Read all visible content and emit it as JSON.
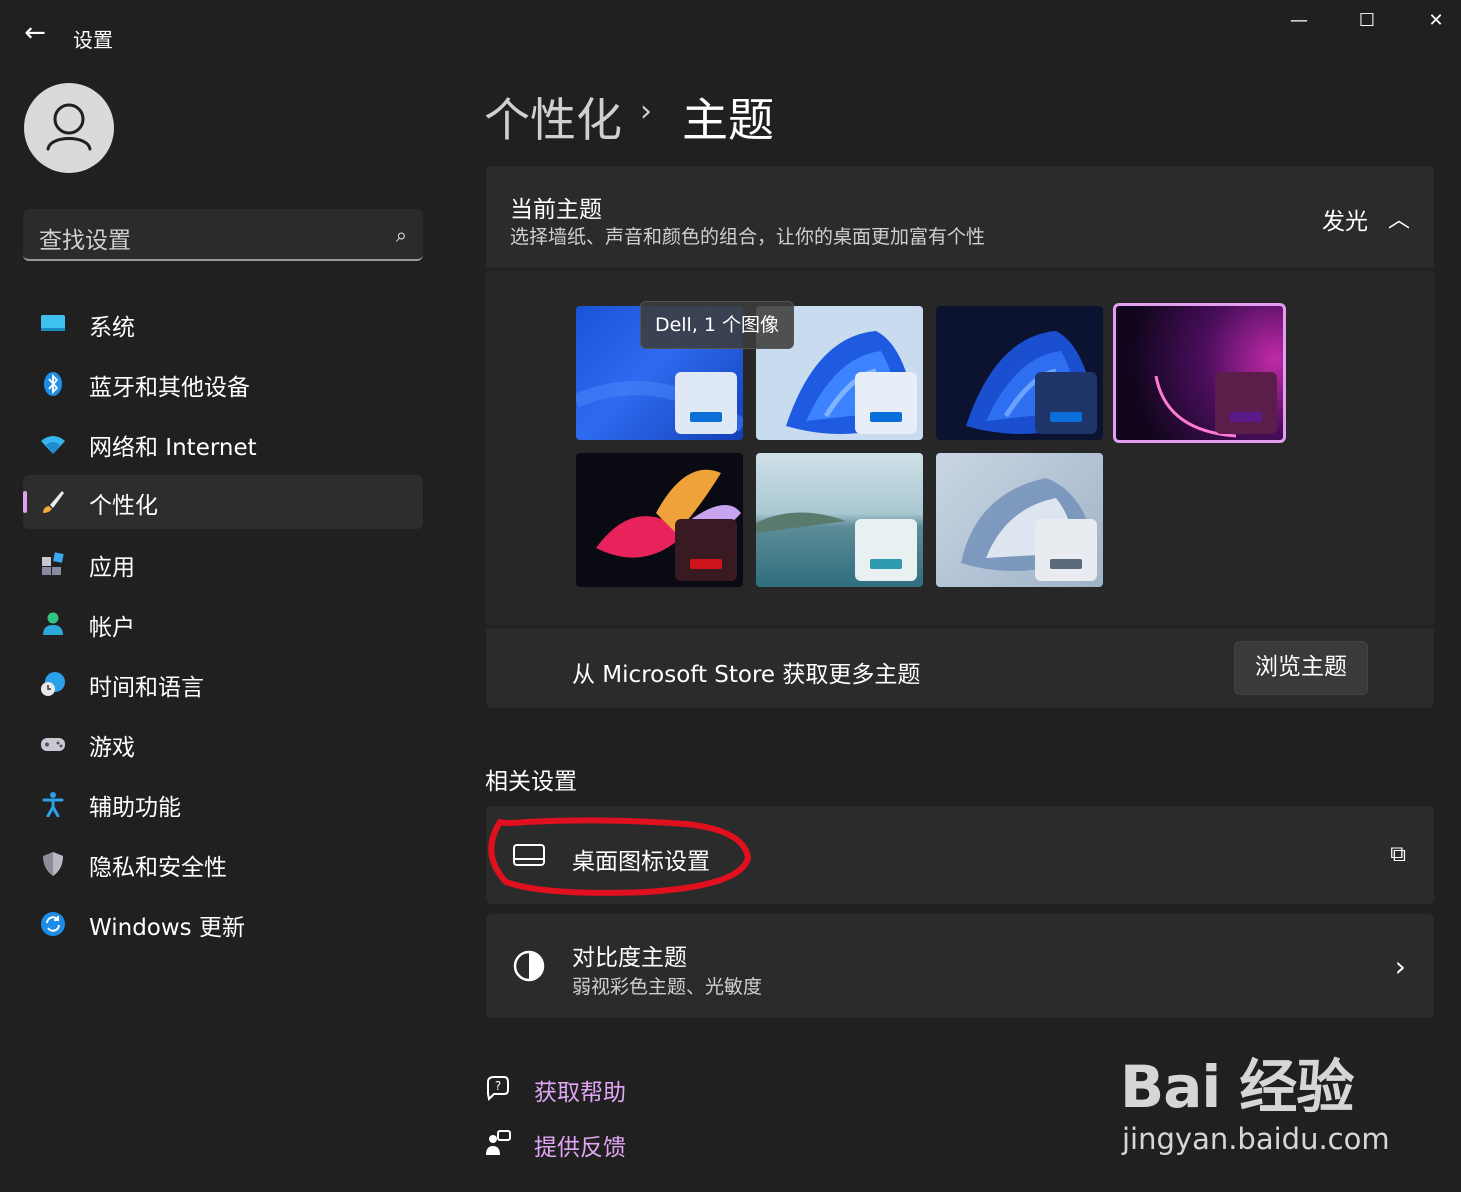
{
  "window": {
    "title": "设置",
    "back_glyph": "←",
    "min_glyph": "—",
    "max_glyph": "☐",
    "close_glyph": "✕"
  },
  "search": {
    "placeholder": "查找设置",
    "icon": "search-icon",
    "icon_glyph": "⌕"
  },
  "sidebar": {
    "items": [
      {
        "label": "系统",
        "icon": "monitor-icon"
      },
      {
        "label": "蓝牙和其他设备",
        "icon": "bluetooth-icon"
      },
      {
        "label": "网络和 Internet",
        "icon": "wifi-icon"
      },
      {
        "label": "个性化",
        "icon": "paintbrush-icon",
        "active": true
      },
      {
        "label": "应用",
        "icon": "apps-icon"
      },
      {
        "label": "帐户",
        "icon": "person-icon"
      },
      {
        "label": "时间和语言",
        "icon": "globe-clock-icon"
      },
      {
        "label": "游戏",
        "icon": "gamepad-icon"
      },
      {
        "label": "辅助功能",
        "icon": "accessibility-icon"
      },
      {
        "label": "隐私和安全性",
        "icon": "shield-icon"
      },
      {
        "label": "Windows 更新",
        "icon": "refresh-icon"
      }
    ]
  },
  "header": {
    "crumb_parent": "个性化",
    "separator": "›",
    "crumb_current": "主题"
  },
  "current_theme": {
    "title": "当前主题",
    "subtitle": "选择墙纸、声音和颜色的组合，让你的桌面更加富有个性",
    "value": "发光",
    "chevron": "︿",
    "tooltip": "Dell, 1 个图像",
    "themes": [
      {
        "name": "dell-blue",
        "bar_color": "#0a6fd8",
        "badge_color": "#dfe8f5"
      },
      {
        "name": "windows-light",
        "bar_color": "#0a6fd8",
        "badge_color": "#e8eef7"
      },
      {
        "name": "windows-dark",
        "bar_color": "#0a6fd8",
        "badge_color": "#1f3468"
      },
      {
        "name": "glow",
        "bar_color": "#5a1a8a",
        "badge_color": "#5b1d4a",
        "selected": true
      },
      {
        "name": "captured-motion",
        "bar_color": "#d0141e",
        "badge_color": "#3a1a22"
      },
      {
        "name": "sunrise",
        "bar_color": "#2e9ab0",
        "badge_color": "#e8f0f2"
      },
      {
        "name": "flow",
        "bar_color": "#5a6a7a",
        "badge_color": "#e8ecf0"
      }
    ],
    "store_text": "从 Microsoft Store 获取更多主题",
    "browse_label": "浏览主题"
  },
  "related": {
    "title": "相关设置",
    "desktop_icons": {
      "label": "桌面图标设置",
      "icon": "desktop-icon",
      "end_icon": "external-link-icon",
      "end_glyph": "⧉"
    },
    "contrast": {
      "label": "对比度主题",
      "sub": "弱视彩色主题、光敏度",
      "icon": "contrast-icon",
      "end_glyph": "›"
    }
  },
  "links": {
    "help": {
      "label": "获取帮助",
      "icon": "help-icon"
    },
    "feedback": {
      "label": "提供反馈",
      "icon": "feedback-icon"
    }
  },
  "watermark": {
    "main": "Bai 经验",
    "sub": "jingyan.baidu.com"
  },
  "colors": {
    "accent": "#e29ff0",
    "link": "#e0a6f3",
    "annotation": "#e0101e"
  }
}
